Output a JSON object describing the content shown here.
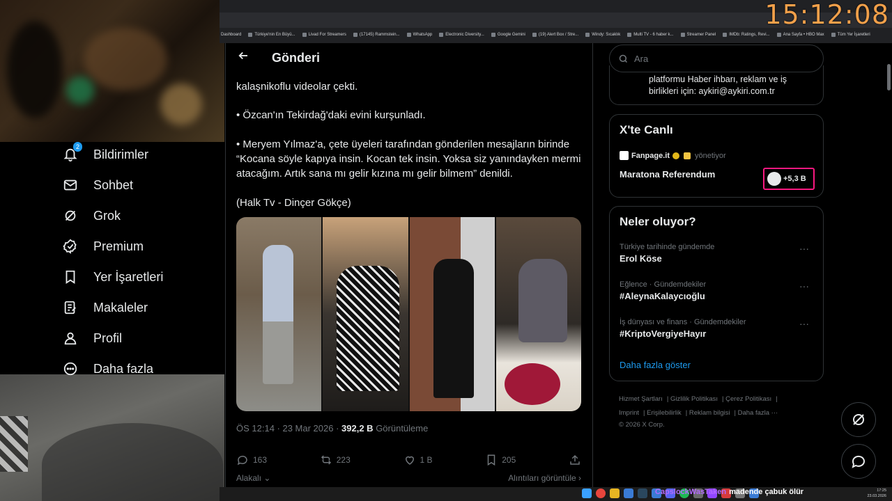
{
  "overlay": {
    "clock": "15:12:08",
    "chat_user": "CapslockWasTaken",
    "chat_message": "madende çabuk ölür"
  },
  "bookmarks": [
    "Dashboard",
    "Türkiye'nin En Büyü...",
    "Livad For Streamers",
    "(17145) Rammstein...",
    "WhatsApp",
    "Electronic Diversity...",
    "Google Gemini",
    "(19) Alert Box / Stre...",
    "Windy: Sıcaklık",
    "Multi TV - 6 haber k...",
    "Streamer Panel",
    "IMDb: Ratings, Revi...",
    "Ana Sayfa • HBO Max",
    "Tüm Yer İşaretleri"
  ],
  "nav": {
    "notifications_badge": "2",
    "items": [
      {
        "label": "Bildirimler"
      },
      {
        "label": "Sohbet"
      },
      {
        "label": "Grok"
      },
      {
        "label": "Premium"
      },
      {
        "label": "Yer İşaretleri"
      },
      {
        "label": "Makaleler"
      },
      {
        "label": "Profil"
      },
      {
        "label": "Daha fazla"
      }
    ]
  },
  "post": {
    "header_title": "Gönderi",
    "text_top": "kalaşnikoflu videolar çekti.",
    "bullet1": "• Özcan'ın Tekirdağ'daki evini kurşunladı.",
    "bullet2": "• Meryem Yılmaz'a, çete üyeleri tarafından gönderilen mesajların birinde “Kocana söyle kapıya insin. Kocan tek insin. Yoksa siz yanındayken mermi atacağım. Artık sana mı gelir kızına mı gelir bilmem” denildi.",
    "source": "(Halk Tv - Dinçer Gökçe)",
    "time": "ÖS 12:14 · 23 Mar 2026 · ",
    "views_count": "392,2 B",
    "views_label": " Görüntüleme",
    "replies": "163",
    "reposts": "223",
    "likes": "1 B",
    "bookmarks": "205",
    "sort_label": "Alakalı",
    "quotes_link": "Alıntıları görüntüle"
  },
  "sidebar": {
    "search_placeholder": "Ara",
    "bio_line1": "platformu Haber ihbarı, reklam ve iş",
    "bio_line2": "birlikleri için: aykiri@aykiri.com.tr",
    "live": {
      "title": "X'te Canlı",
      "host": "Fanpage.it",
      "host_suffix": "yönetiyor",
      "stream_title": "Maratona Referendum",
      "listeners": "+5,3 B"
    },
    "trends": {
      "title": "Neler oluyor?",
      "items": [
        {
          "category": "Türkiye tarihinde gündemde",
          "name": "Erol Köse"
        },
        {
          "category": "Eğlence · Gündemdekiler",
          "name": "#AleynaKalaycıoğlu"
        },
        {
          "category": "İş dünyası ve finans · Gündemdekiler",
          "name": "#KriptoVergiyeHayır"
        }
      ],
      "show_more": "Daha fazla göster"
    },
    "footer": {
      "links": [
        "Hizmet Şartları",
        "Gizlilik Politikası",
        "Çerez Politikası",
        "Imprint",
        "Erişilebilirlik",
        "Reklam bilgisi",
        "Daha fazla ···"
      ],
      "copyright": "© 2026 X Corp."
    }
  },
  "taskbar": {
    "time": "17:25",
    "date": "23.03.2026"
  },
  "colors": {
    "accent": "#1d9bf0",
    "clock": "#f2a04a",
    "chat_user": "#b46bff",
    "live_border": "#f91880"
  }
}
